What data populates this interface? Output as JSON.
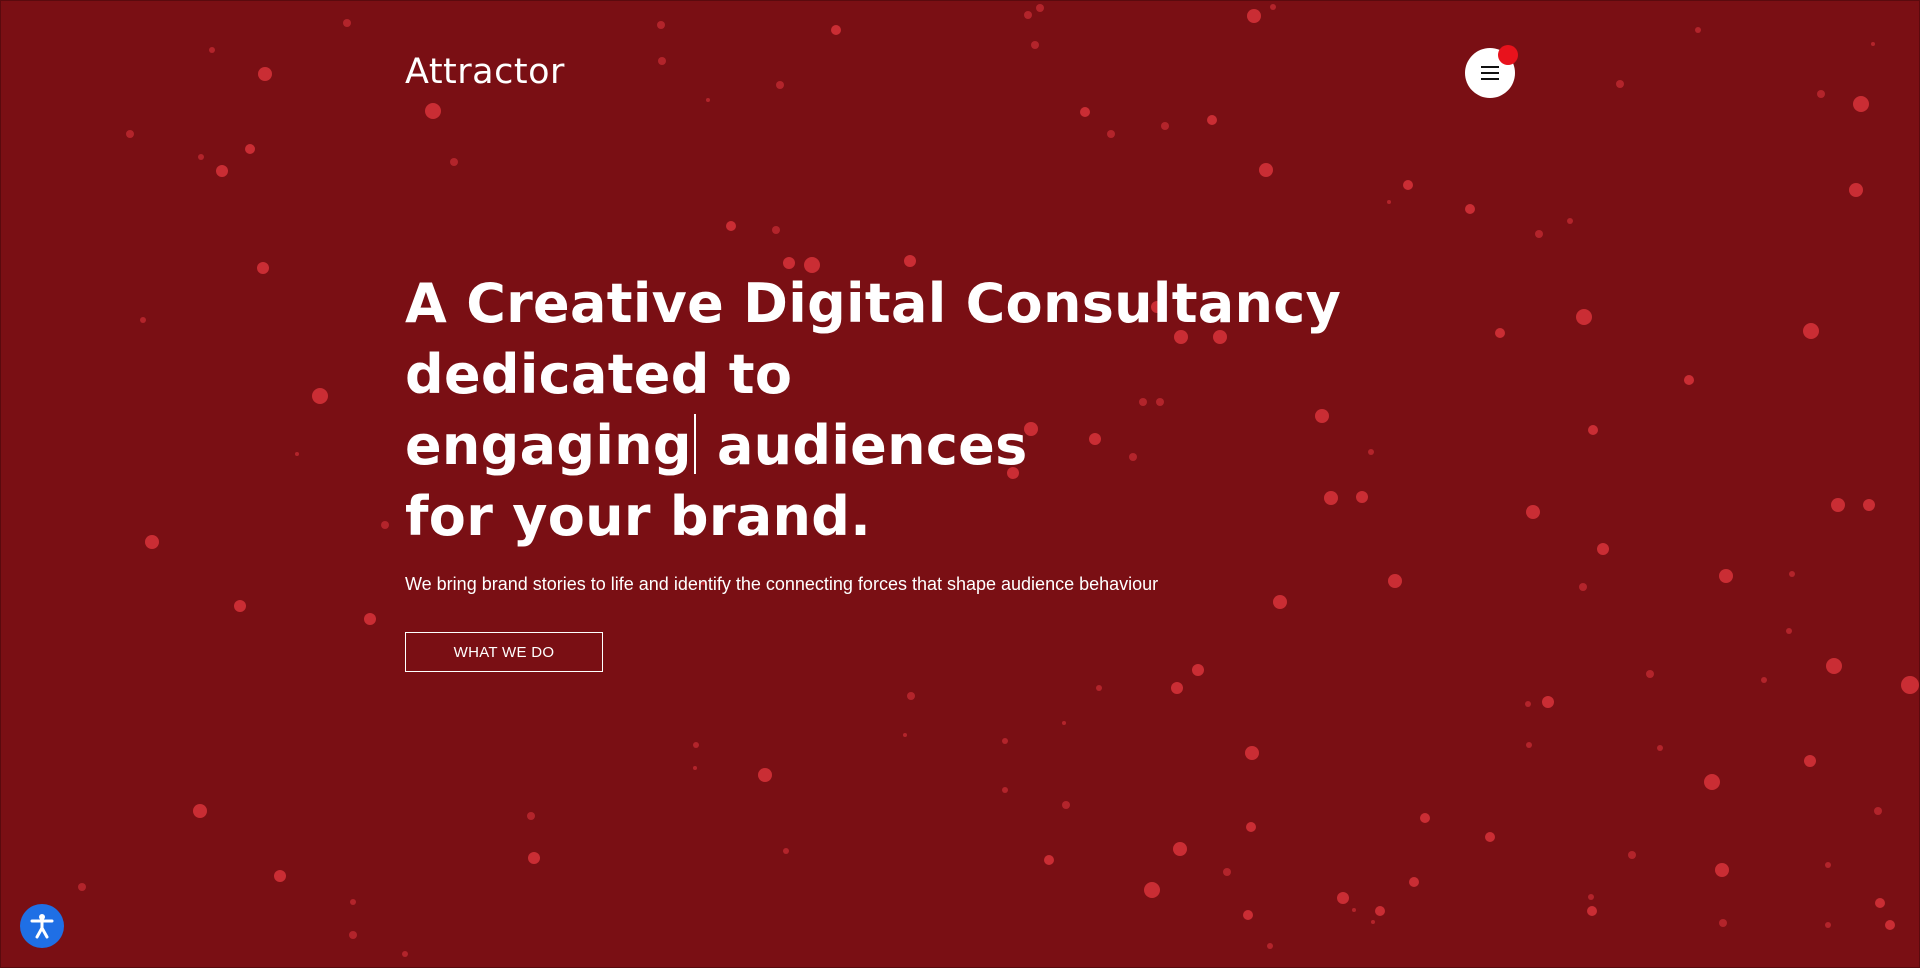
{
  "brand": {
    "logo_text": "Attractor"
  },
  "header": {
    "menu_icon": "hamburger-menu-icon",
    "notification_dot_color": "#e8121c"
  },
  "hero": {
    "headline_lines": [
      "A Creative Digital Consultancy",
      "dedicated to",
      "engaging",
      "audiences",
      "for your brand."
    ],
    "subline": "We bring brand stories to life and identify the connecting forces that shape audience behaviour",
    "cta_label": "WHAT WE DO"
  },
  "accessibility": {
    "icon": "accessibility-icon",
    "color": "#1f6fe5"
  },
  "theme": {
    "background": "#7a0f14",
    "particle_color": "#d8323a"
  }
}
